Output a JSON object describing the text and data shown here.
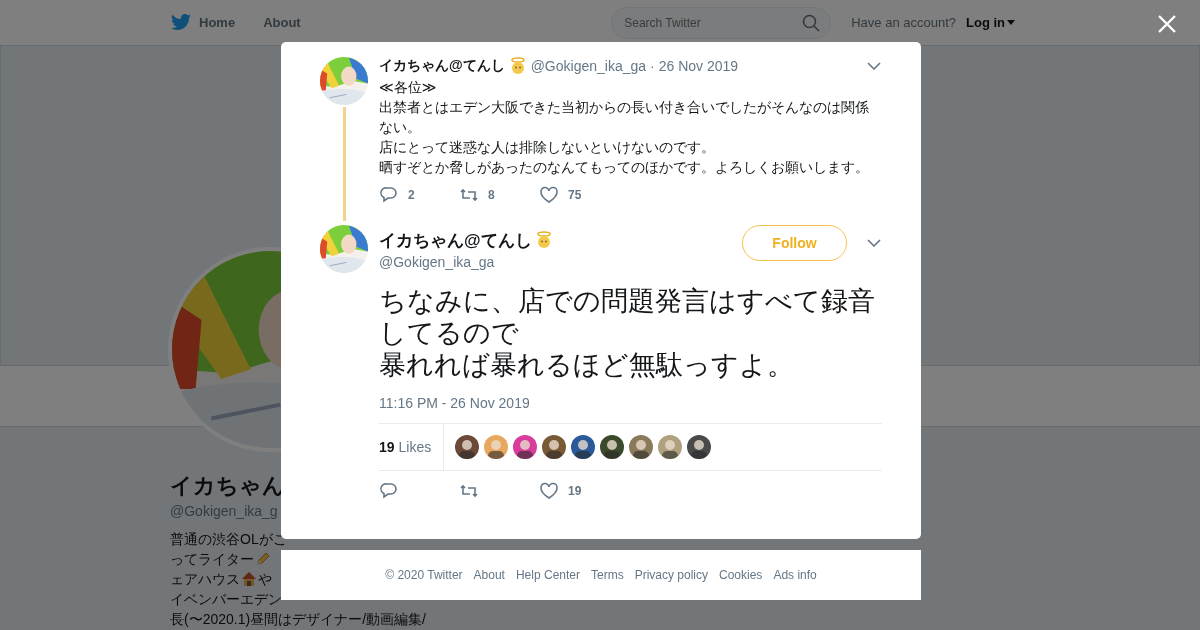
{
  "header": {
    "nav": [
      "Home",
      "About"
    ],
    "search": {
      "placeholder": "Search Twitter"
    },
    "account_prompt": "Have an account?",
    "login": "Log in"
  },
  "profile": {
    "name": "イカちゃん",
    "handle": "@Gokigen_ika_g",
    "bio": [
      [
        {
          "kind": "text",
          "text": "普通の渋谷OLがこ"
        }
      ],
      [
        {
          "kind": "text",
          "text": "ってライター"
        },
        {
          "kind": "pencil"
        }
      ],
      [
        {
          "kind": "text",
          "text": "ェアハウス"
        },
        {
          "kind": "house"
        },
        {
          "kind": "text",
          "text": "や"
        }
      ],
      [
        {
          "kind": "text",
          "text": "イベンバーエデン"
        }
      ],
      [
        {
          "kind": "text",
          "text": "長(〜2020.1)昼間はデザイナー/動画編集/"
        }
      ]
    ]
  },
  "modal": {
    "parent_tweet": {
      "name": "イカちゃん@てんし",
      "handle": "@Gokigen_ika_ga",
      "separator": "·",
      "date": "26 Nov 2019",
      "text": [
        "≪各位≫",
        "出禁者とはエデン大阪できた当初からの長い付き合いでしたがそんなのは関係ない。",
        "店にとって迷惑な人は排除しないといけないのです。",
        "晒すぞとか脅しがあったのなんてもってのほかです。よろしくお願いします。"
      ],
      "replies": "2",
      "retweets": "8",
      "likes": "75"
    },
    "main_tweet": {
      "name": "イカちゃん@てんし",
      "handle": "@Gokigen_ika_ga",
      "follow": "Follow",
      "text": [
        "ちなみに、店での問題発言はすべて録音してるので",
        "暴れれば暴れるほど無駄っすよ。"
      ],
      "timestamp": "11:16 PM - 26 Nov 2019",
      "like_count": "19",
      "like_label": "Likes",
      "likers": [
        {
          "color": "#6b4a3a"
        },
        {
          "color": "#e8a860"
        },
        {
          "color": "#d83c9c"
        },
        {
          "color": "#7a5a36"
        },
        {
          "color": "#2a5a9a"
        },
        {
          "color": "#3a4a2a"
        },
        {
          "color": "#8a7a5a"
        },
        {
          "color": "#b0a080"
        },
        {
          "color": "#4a4a4a"
        }
      ],
      "likes": "19"
    }
  },
  "footer": [
    "© 2020 Twitter",
    "About",
    "Help Center",
    "Terms",
    "Privacy policy",
    "Cookies",
    "Ads info"
  ]
}
